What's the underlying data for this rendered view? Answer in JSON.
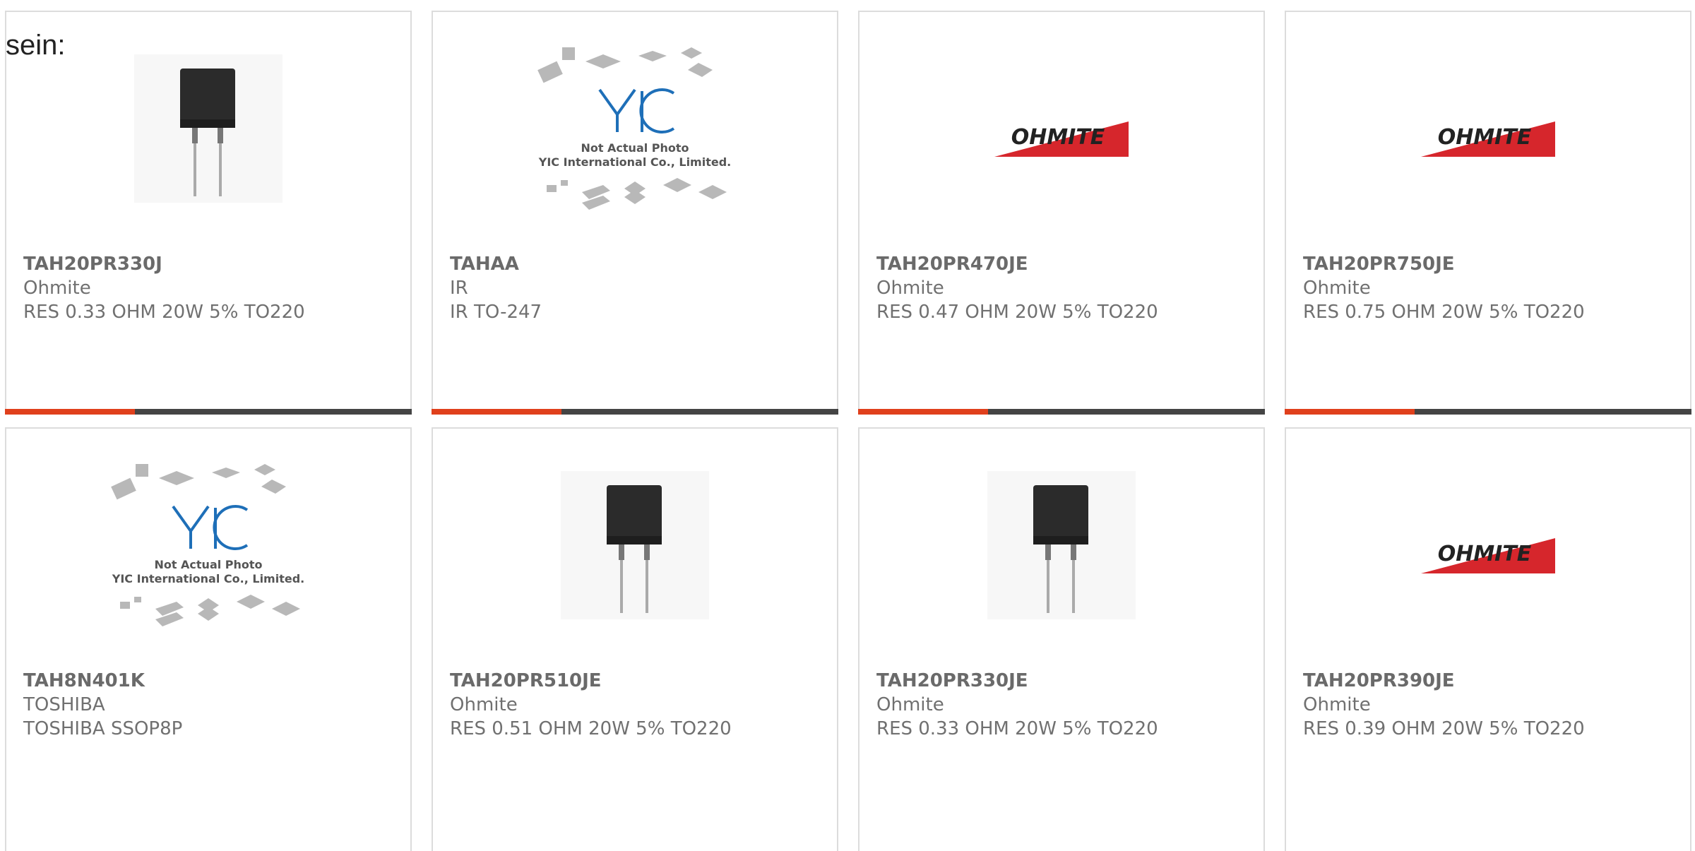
{
  "intro_text": "sein:",
  "products": [
    {
      "part": "TAH20PR330J",
      "brand": "Ohmite",
      "desc": "RES 0.33 OHM 20W 5% TO220",
      "image": "resistor-photo"
    },
    {
      "part": "TAHAA",
      "brand": "IR",
      "desc": "IR TO-247",
      "image": "placeholder-photo"
    },
    {
      "part": "TAH20PR470JE",
      "brand": "Ohmite",
      "desc": "RES 0.47 OHM 20W 5% TO220",
      "image": "ohmite-logo"
    },
    {
      "part": "TAH20PR750JE",
      "brand": "Ohmite",
      "desc": "RES 0.75 OHM 20W 5% TO220",
      "image": "ohmite-logo"
    },
    {
      "part": "TAH8N401K",
      "brand": "TOSHIBA",
      "desc": "TOSHIBA SSOP8P",
      "image": "placeholder-photo"
    },
    {
      "part": "TAH20PR510JE",
      "brand": "Ohmite",
      "desc": "RES 0.51 OHM 20W 5% TO220",
      "image": "resistor-photo"
    },
    {
      "part": "TAH20PR330JE",
      "brand": "Ohmite",
      "desc": "RES 0.33 OHM 20W 5% TO220",
      "image": "resistor-photo"
    },
    {
      "part": "TAH20PR390JE",
      "brand": "Ohmite",
      "desc": "RES 0.39 OHM 20W 5% TO220",
      "image": "ohmite-logo"
    }
  ],
  "placeholder": {
    "logo_text": "YIC",
    "line1": "Not Actual Photo",
    "line2": "YIC International Co., Limited."
  },
  "ohmite_logo_text": "OHMITE",
  "colors": {
    "accent": "#e0401c",
    "bar": "#444444",
    "border": "#dcdcdc",
    "ohmite_red": "#d6262c"
  }
}
